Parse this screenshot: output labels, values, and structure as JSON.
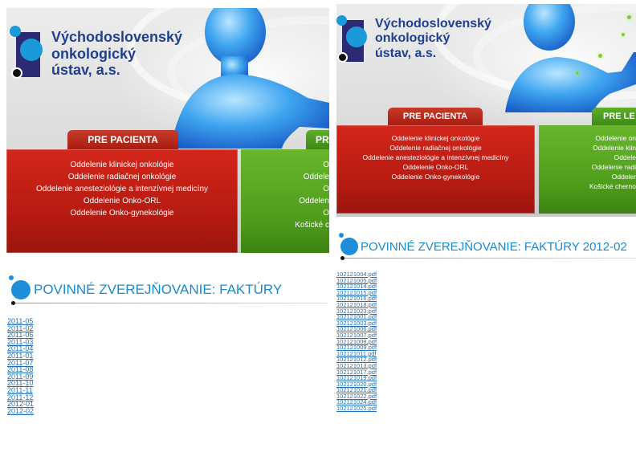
{
  "left_page": {
    "org_name": [
      "Východoslovenský",
      "onkologický",
      "ústav, a.s."
    ],
    "tab_patient": "PRE PACIENTA",
    "tab_green": "PR",
    "patient_links": [
      "Oddelenie klinickej onkológie",
      "Oddelenie radiačnej onkológie",
      "Oddelenie anesteziológie a intenzívnej medicíny",
      "Oddelenie Onko-ORL",
      "Oddelenie Onko-gynekológie"
    ],
    "green_links": [
      "O",
      "Oddele",
      "O",
      "Oddelen",
      "O",
      "Košické c"
    ],
    "heading": "POVINNÉ ZVEREJŇOVANIE: FAKTÚRY",
    "months": [
      "2011-05",
      "2011-02",
      "2011-06",
      "2011-03",
      "2011-04",
      "2011-01",
      "2011-07",
      "2011-08",
      "2011-09",
      "2011-10",
      "2011-11",
      "2011-12",
      "2012-01",
      "2012-02"
    ]
  },
  "right_page": {
    "org_name": [
      "Východoslovenský",
      "onkologický",
      "ústav, a.s."
    ],
    "tab_patient": "PRE PACIENTA",
    "tab_green": "PRE LE",
    "patient_links": [
      "Oddelenie klinickej onkológie",
      "Oddelenie radiačnej onkológie",
      "Oddelenie anesteziológie a intenzívnej medicíny",
      "Oddelenie Onko-ORL",
      "Oddelenie Onko-gynekológie"
    ],
    "green_links": [
      "Oddelenie on",
      "Oddelenie klin",
      "Oddele",
      "Oddelenie radi",
      "Oddeler",
      "Košické cherno"
    ],
    "heading": "POVINNÉ ZVEREJŇOVANIE: FAKTÚRY 2012-02",
    "files": [
      "102121004.pdf",
      "102121005.pdf",
      "102121014.pdf",
      "102121015.pdf",
      "102121016.pdf",
      "102121018.pdf",
      "102121023.pdf",
      "102121001.pdf",
      "102121003.pdf",
      "102121006.pdf",
      "102121007.pdf",
      "102121008.pdf",
      "102121009.pdf",
      "102121011.pdf",
      "102121012.pdf",
      "102121013.pdf",
      "102121017.pdf",
      "102121019.pdf",
      "102121020.pdf",
      "102121021.pdf",
      "102121022.pdf",
      "102121024.pdf",
      "102121025.pdf"
    ]
  },
  "colors": {
    "brand_blue": "#1d8fd9",
    "logo_navy": "#2b2a72",
    "patient_red": "#c42116",
    "green": "#4e9b1b",
    "link": "#1f6fbf"
  }
}
